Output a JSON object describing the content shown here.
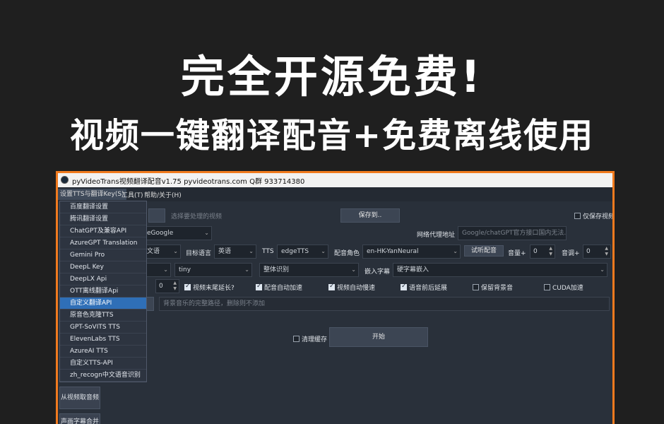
{
  "hero": {
    "line1": "完全开源免费!",
    "line2": "视频一键翻译配音+免费离线使用"
  },
  "window": {
    "title": "pyVideoTrans视频翻译配音v1.75 pyvideotrans.com  Q群 933714380"
  },
  "menubar": {
    "items": [
      "设置TTS与翻译Key(S)",
      "工具(T)",
      "帮助/关于(H)"
    ]
  },
  "dropdown_menu": {
    "items": [
      "百度翻译设置",
      "腾讯翻译设置",
      "ChatGPT及兼容API",
      "AzureGPT Translation",
      "Gemini Pro",
      "DeepL Key",
      "DeepLX Api",
      "OTT离线翻译Api",
      "自定义翻译API",
      "原音色克隆TTS",
      "GPT-SoVITS TTS",
      "ElevenLabs TTS",
      "AzureAI TTS",
      "自定义TTS-API",
      "zh_recogn中文语音识别"
    ],
    "highlighted_index": 8
  },
  "row1": {
    "select_video_placeholder": "选择要处理的视频",
    "save_to_button": "保存到..",
    "only_save_video": "仅保存视频"
  },
  "row2": {
    "translate_engine": "eGoogle",
    "proxy_label": "网络代理地址",
    "proxy_placeholder": "Google/chatGPT官方接口国内无法..."
  },
  "row3": {
    "source_lang": "文语",
    "target_lang_label": "目标语言",
    "target_lang": "英语",
    "tts_label": "TTS",
    "tts_value": "edgeTTS",
    "voice_role_label": "配音角色",
    "voice_role": "en-HK-YanNeural",
    "test_dub_button": "试听配音",
    "volume_label": "音量+",
    "volume_value": "0",
    "pitch_label": "音调+",
    "pitch_value": "0"
  },
  "row4": {
    "model": "tiny",
    "recog_mode": "整体识别",
    "embed_sub_label": "嵌入字幕",
    "embed_sub_value": "硬字幕嵌入"
  },
  "row5": {
    "spin_value": "0",
    "opt1": "视频末尾延长?",
    "opt2": "配音自动加速",
    "opt3": "视频自动慢速",
    "opt4": "语音前后延展",
    "opt5": "保留背景音",
    "opt6": "CUDA加速"
  },
  "row6": {
    "bg_music_placeholder": "背景音乐的完整路径，删除则不添加"
  },
  "row7": {
    "clear_cache": "清理缓存",
    "start_button": "开始"
  },
  "left_panel": {
    "extract_audio": "从视频取音频",
    "merge_subs": "声画字幕合并"
  }
}
